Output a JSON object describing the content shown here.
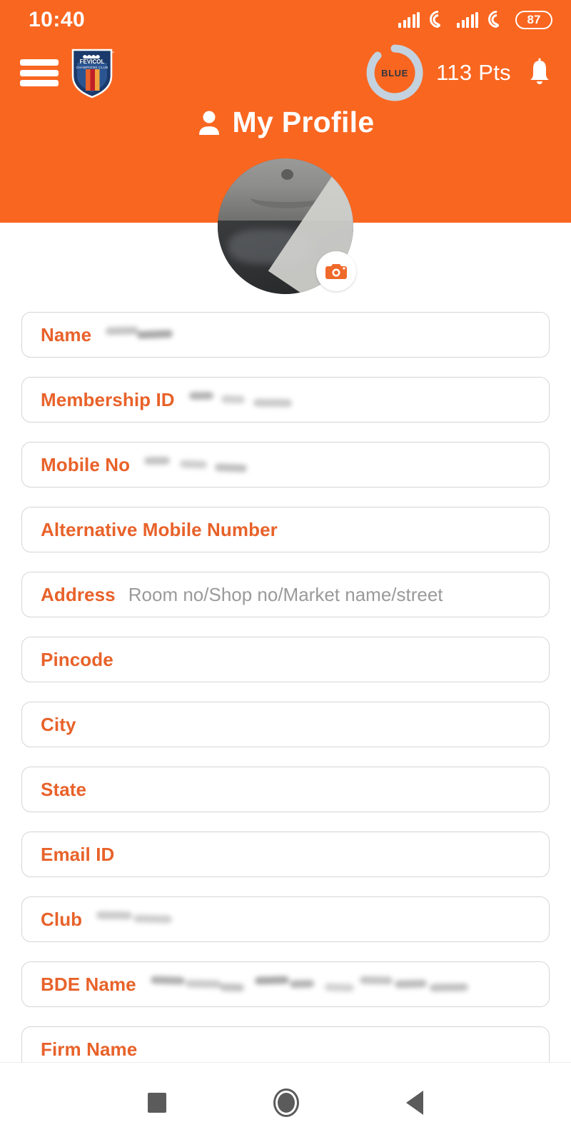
{
  "status_bar": {
    "time": "10:40",
    "battery_level": "87",
    "icons": [
      "signal-bars-icon",
      "wifi-icon",
      "signal-bars-icon",
      "wifi-icon",
      "battery-icon"
    ]
  },
  "app_bar": {
    "menu_icon": "hamburger-menu-icon",
    "logo_name": "Fevicol Champions Club",
    "logo_line1": "FEVICOL",
    "logo_line2": "CHAMPIONS CLUB",
    "tier_label": "BLUE",
    "points": "113 Pts",
    "notification_icon": "bell-icon"
  },
  "page": {
    "title": "My Profile",
    "title_icon": "person-icon"
  },
  "avatar": {
    "name": "profile-photo",
    "edit_icon": "camera-icon"
  },
  "form": {
    "fields": [
      {
        "label": "Name",
        "value_redacted": true,
        "redact_width": 96,
        "placeholder": ""
      },
      {
        "label": "Membership ID",
        "value_redacted": true,
        "redact_width": 148,
        "placeholder": ""
      },
      {
        "label": "Mobile No",
        "value_redacted": true,
        "redact_width": 162,
        "placeholder": ""
      },
      {
        "label": "Alternative Mobile Number",
        "value_redacted": false,
        "redact_width": 0,
        "placeholder": ""
      },
      {
        "label": "Address",
        "value_redacted": false,
        "redact_width": 0,
        "placeholder": "Room no/Shop no/Market name/street"
      },
      {
        "label": "Pincode",
        "value_redacted": false,
        "redact_width": 0,
        "placeholder": ""
      },
      {
        "label": "City",
        "value_redacted": false,
        "redact_width": 0,
        "placeholder": ""
      },
      {
        "label": "State",
        "value_redacted": false,
        "redact_width": 0,
        "placeholder": ""
      },
      {
        "label": "Email ID",
        "value_redacted": false,
        "redact_width": 0,
        "placeholder": ""
      },
      {
        "label": "Club",
        "value_redacted": true,
        "redact_width": 112,
        "placeholder": ""
      },
      {
        "label": "BDE Name",
        "value_redacted": true,
        "redact_width": 478,
        "placeholder": ""
      },
      {
        "label": "Firm Name",
        "value_redacted": false,
        "redact_width": 0,
        "placeholder": ""
      }
    ]
  },
  "nav_bar": {
    "recents_label": "recents-button",
    "home_label": "home-button",
    "back_label": "back-button"
  },
  "colors": {
    "brand_orange": "#f96620",
    "label_orange": "#e8622a",
    "placeholder_gray": "#9a9a9a",
    "field_border": "#d5d5d5",
    "tier_ring": "#c3d2de"
  }
}
